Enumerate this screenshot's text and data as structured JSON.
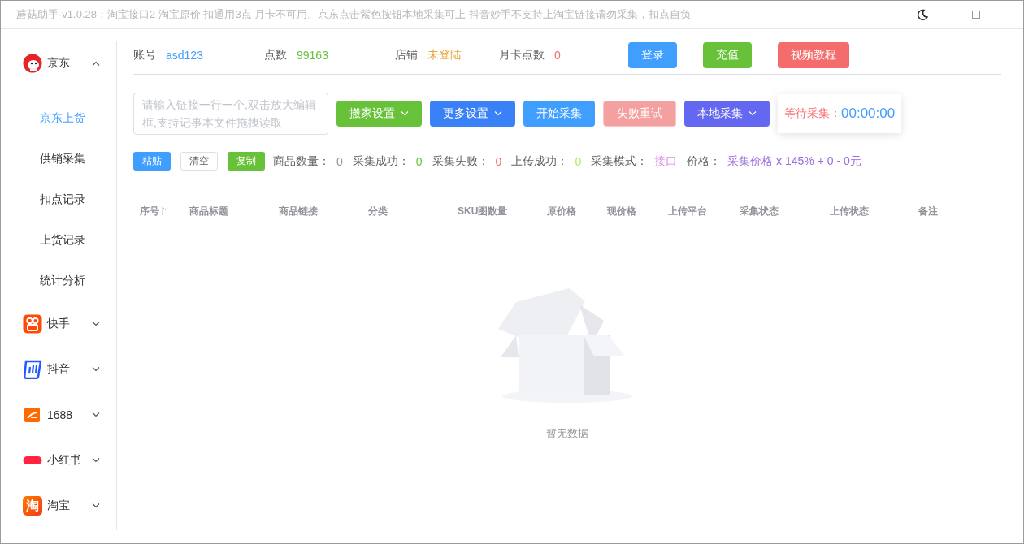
{
  "window": {
    "title": "蘑菇助手-v1.0.28：淘宝接口2 淘宝原价 扣通用3点 月卡不可用。京东点击紫色按钮本地采集可上 抖音妙手不支持上淘宝链接请勿采集，扣点自负"
  },
  "sidebar": {
    "groups": [
      {
        "label": "京东",
        "expanded": true,
        "children": [
          {
            "label": "京东上货",
            "selected": true
          },
          {
            "label": "供销采集",
            "selected": false
          },
          {
            "label": "扣点记录",
            "selected": false
          },
          {
            "label": "上货记录",
            "selected": false
          },
          {
            "label": "统计分析",
            "selected": false
          }
        ]
      },
      {
        "label": "快手",
        "expanded": false
      },
      {
        "label": "抖音",
        "expanded": false
      },
      {
        "label": "1688",
        "expanded": false
      },
      {
        "label": "小红书",
        "expanded": false
      },
      {
        "label": "淘宝",
        "expanded": false,
        "logo_text": "淘"
      }
    ]
  },
  "account": [
    {
      "label": "账号",
      "value": "asd123",
      "color": "#409eff"
    },
    {
      "label": "点数",
      "value": "99163",
      "color": "#67c23a"
    },
    {
      "label": "店铺",
      "value": "未登陆",
      "color": "#e6a23c"
    },
    {
      "label": "月卡点数",
      "value": "0",
      "color": "#f56c6c"
    }
  ],
  "account_buttons": [
    {
      "label": "登录",
      "color": "#409eff"
    },
    {
      "label": "充值",
      "color": "#67c23a"
    },
    {
      "label": "视频教程",
      "color": "#f56c6c"
    }
  ],
  "link_input": {
    "placeholder": "请输入链接一行一个,双击放大编辑框,支持记事本文件拖拽读取"
  },
  "toolbar": [
    {
      "label": "搬家设置",
      "color": "#67c23a",
      "dropdown": true,
      "disabled": false
    },
    {
      "label": "更多设置",
      "color": "#3a80f6",
      "dropdown": true,
      "disabled": false
    },
    {
      "label": "开始采集",
      "color": "#409eff",
      "dropdown": false,
      "disabled": false
    },
    {
      "label": "失败重试",
      "color": "#f5a0a0",
      "dropdown": false,
      "disabled": true
    },
    {
      "label": "本地采集",
      "color": "#6467f0",
      "dropdown": true,
      "disabled": false
    }
  ],
  "timer": {
    "label": "等待采集：",
    "value": "00:00:00"
  },
  "small_buttons": [
    {
      "label": "粘贴",
      "kind": "primary"
    },
    {
      "label": "清空",
      "kind": "plain"
    },
    {
      "label": "复制",
      "kind": "success"
    }
  ],
  "stats": [
    {
      "label": "商品数量：",
      "value": "0",
      "color": "#909399"
    },
    {
      "label": "采集成功：",
      "value": "0",
      "color": "#67c23a"
    },
    {
      "label": "采集失败：",
      "value": "0",
      "color": "#f56c6c"
    },
    {
      "label": "上传成功：",
      "value": "0",
      "color": "#a6f25d"
    },
    {
      "label": "采集模式：",
      "value": "接口",
      "color": "#d78be6"
    },
    {
      "label": "价格：",
      "value": "采集价格 x 145% + 0 - 0元",
      "color": "#9b6ddb"
    }
  ],
  "table": {
    "columns": [
      {
        "label": "序号",
        "sortable": true
      },
      {
        "label": "商品标题",
        "sortable": false
      },
      {
        "label": "商品链接",
        "sortable": false
      },
      {
        "label": "分类",
        "sortable": false
      },
      {
        "label": "SKU图数量",
        "sortable": false
      },
      {
        "label": "原价格",
        "sortable": false
      },
      {
        "label": "现价格",
        "sortable": false
      },
      {
        "label": "上传平台",
        "sortable": false
      },
      {
        "label": "采集状态",
        "sortable": false
      },
      {
        "label": "上传状态",
        "sortable": false
      },
      {
        "label": "备注",
        "sortable": false
      }
    ],
    "empty_text": "暂无数据"
  }
}
